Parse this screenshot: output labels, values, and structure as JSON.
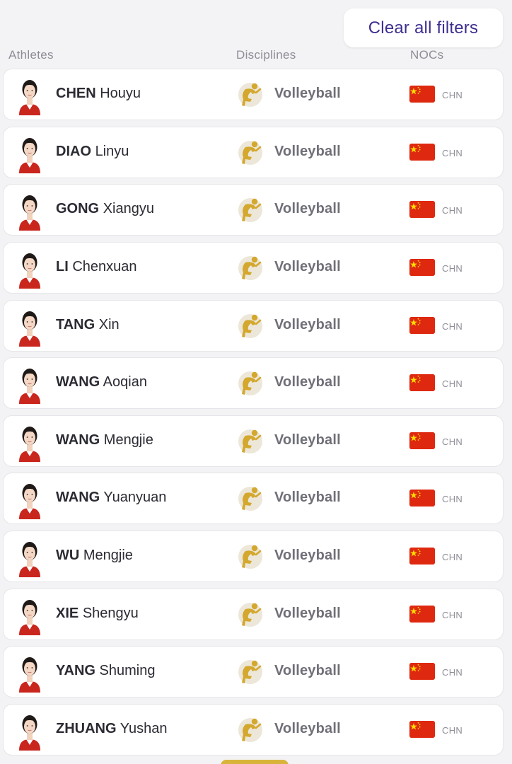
{
  "header": {
    "clear_filters_label": "Clear all filters",
    "col_athletes": "Athletes",
    "col_disciplines": "Disciplines",
    "col_nocs": "NOCs"
  },
  "colors": {
    "accent": "#3d2f8f",
    "gold": "#d4a82e",
    "flag_red": "#de2910",
    "flag_yellow": "#ffde00"
  },
  "athletes": [
    {
      "surname": "CHEN",
      "given": "Houyu",
      "discipline": "Volleyball",
      "noc": "CHN",
      "discipline_icon": "volleyball-pictogram-icon",
      "flag_icon": "china-flag-icon"
    },
    {
      "surname": "DIAO",
      "given": "Linyu",
      "discipline": "Volleyball",
      "noc": "CHN",
      "discipline_icon": "volleyball-pictogram-icon",
      "flag_icon": "china-flag-icon"
    },
    {
      "surname": "GONG",
      "given": "Xiangyu",
      "discipline": "Volleyball",
      "noc": "CHN",
      "discipline_icon": "volleyball-pictogram-icon",
      "flag_icon": "china-flag-icon"
    },
    {
      "surname": "LI",
      "given": "Chenxuan",
      "discipline": "Volleyball",
      "noc": "CHN",
      "discipline_icon": "volleyball-pictogram-icon",
      "flag_icon": "china-flag-icon"
    },
    {
      "surname": "TANG",
      "given": "Xin",
      "discipline": "Volleyball",
      "noc": "CHN",
      "discipline_icon": "volleyball-pictogram-icon",
      "flag_icon": "china-flag-icon"
    },
    {
      "surname": "WANG",
      "given": "Aoqian",
      "discipline": "Volleyball",
      "noc": "CHN",
      "discipline_icon": "volleyball-pictogram-icon",
      "flag_icon": "china-flag-icon"
    },
    {
      "surname": "WANG",
      "given": "Mengjie",
      "discipline": "Volleyball",
      "noc": "CHN",
      "discipline_icon": "volleyball-pictogram-icon",
      "flag_icon": "china-flag-icon"
    },
    {
      "surname": "WANG",
      "given": "Yuanyuan",
      "discipline": "Volleyball",
      "noc": "CHN",
      "discipline_icon": "volleyball-pictogram-icon",
      "flag_icon": "china-flag-icon"
    },
    {
      "surname": "WU",
      "given": "Mengjie",
      "discipline": "Volleyball",
      "noc": "CHN",
      "discipline_icon": "volleyball-pictogram-icon",
      "flag_icon": "china-flag-icon"
    },
    {
      "surname": "XIE",
      "given": "Shengyu",
      "discipline": "Volleyball",
      "noc": "CHN",
      "discipline_icon": "volleyball-pictogram-icon",
      "flag_icon": "china-flag-icon"
    },
    {
      "surname": "YANG",
      "given": "Shuming",
      "discipline": "Volleyball",
      "noc": "CHN",
      "discipline_icon": "volleyball-pictogram-icon",
      "flag_icon": "china-flag-icon"
    },
    {
      "surname": "ZHUANG",
      "given": "Yushan",
      "discipline": "Volleyball",
      "noc": "CHN",
      "discipline_icon": "volleyball-pictogram-icon",
      "flag_icon": "china-flag-icon"
    }
  ]
}
